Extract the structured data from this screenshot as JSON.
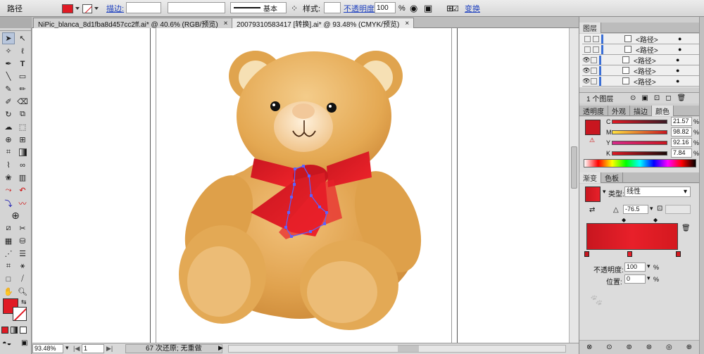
{
  "control_bar": {
    "object_type": "路径",
    "stroke_label": "描边:",
    "stroke_style": "基本",
    "style_label": "样式:",
    "opacity_label": "不透明度:",
    "opacity_value": "100",
    "opacity_unit": "%",
    "transform_label": "变换",
    "fill_color": "#e01a24"
  },
  "tabs": [
    {
      "label": "NiPic_blanca_8d1fba8d457cc2ff.ai* @ 40.6% (RGB/预览)",
      "close": "×"
    },
    {
      "label": "20079310583417 [转换].ai* @ 93.48% (CMYK/预览)",
      "close": "×"
    }
  ],
  "status_bar": {
    "zoom": "93.48%",
    "page": "1",
    "history": "67 次还原; 无重做"
  },
  "layers_panel": {
    "title": "图层",
    "rows": [
      "<路径>",
      "<路径>",
      "<路径>",
      "<路径>",
      "<路径>"
    ],
    "footer": "1 个图层"
  },
  "color_panel": {
    "tabs": [
      "透明度",
      "外观",
      "描边",
      "颜色"
    ],
    "channels": [
      {
        "name": "C",
        "value": "21.57",
        "unit": "%"
      },
      {
        "name": "M",
        "value": "98.82",
        "unit": "%"
      },
      {
        "name": "Y",
        "value": "92.16",
        "unit": "%"
      },
      {
        "name": "K",
        "value": "7.84",
        "unit": "%"
      }
    ],
    "swatch": "#c8161f"
  },
  "gradient_panel": {
    "tabs": [
      "渐变",
      "色板"
    ],
    "type_label": "类型:",
    "type_value": "线性",
    "angle_value": "-76.5",
    "opacity_label": "不透明度:",
    "opacity_value": "100",
    "position_label": "位置:",
    "position_value": "0",
    "unit": "%",
    "start_color": "#c8161f",
    "end_color": "#e8202a"
  },
  "colors": {
    "bear_fur": "#e0a64c",
    "bear_light": "#f6d7a6",
    "bow": "#e11c22",
    "selection": "#5b62ff"
  }
}
